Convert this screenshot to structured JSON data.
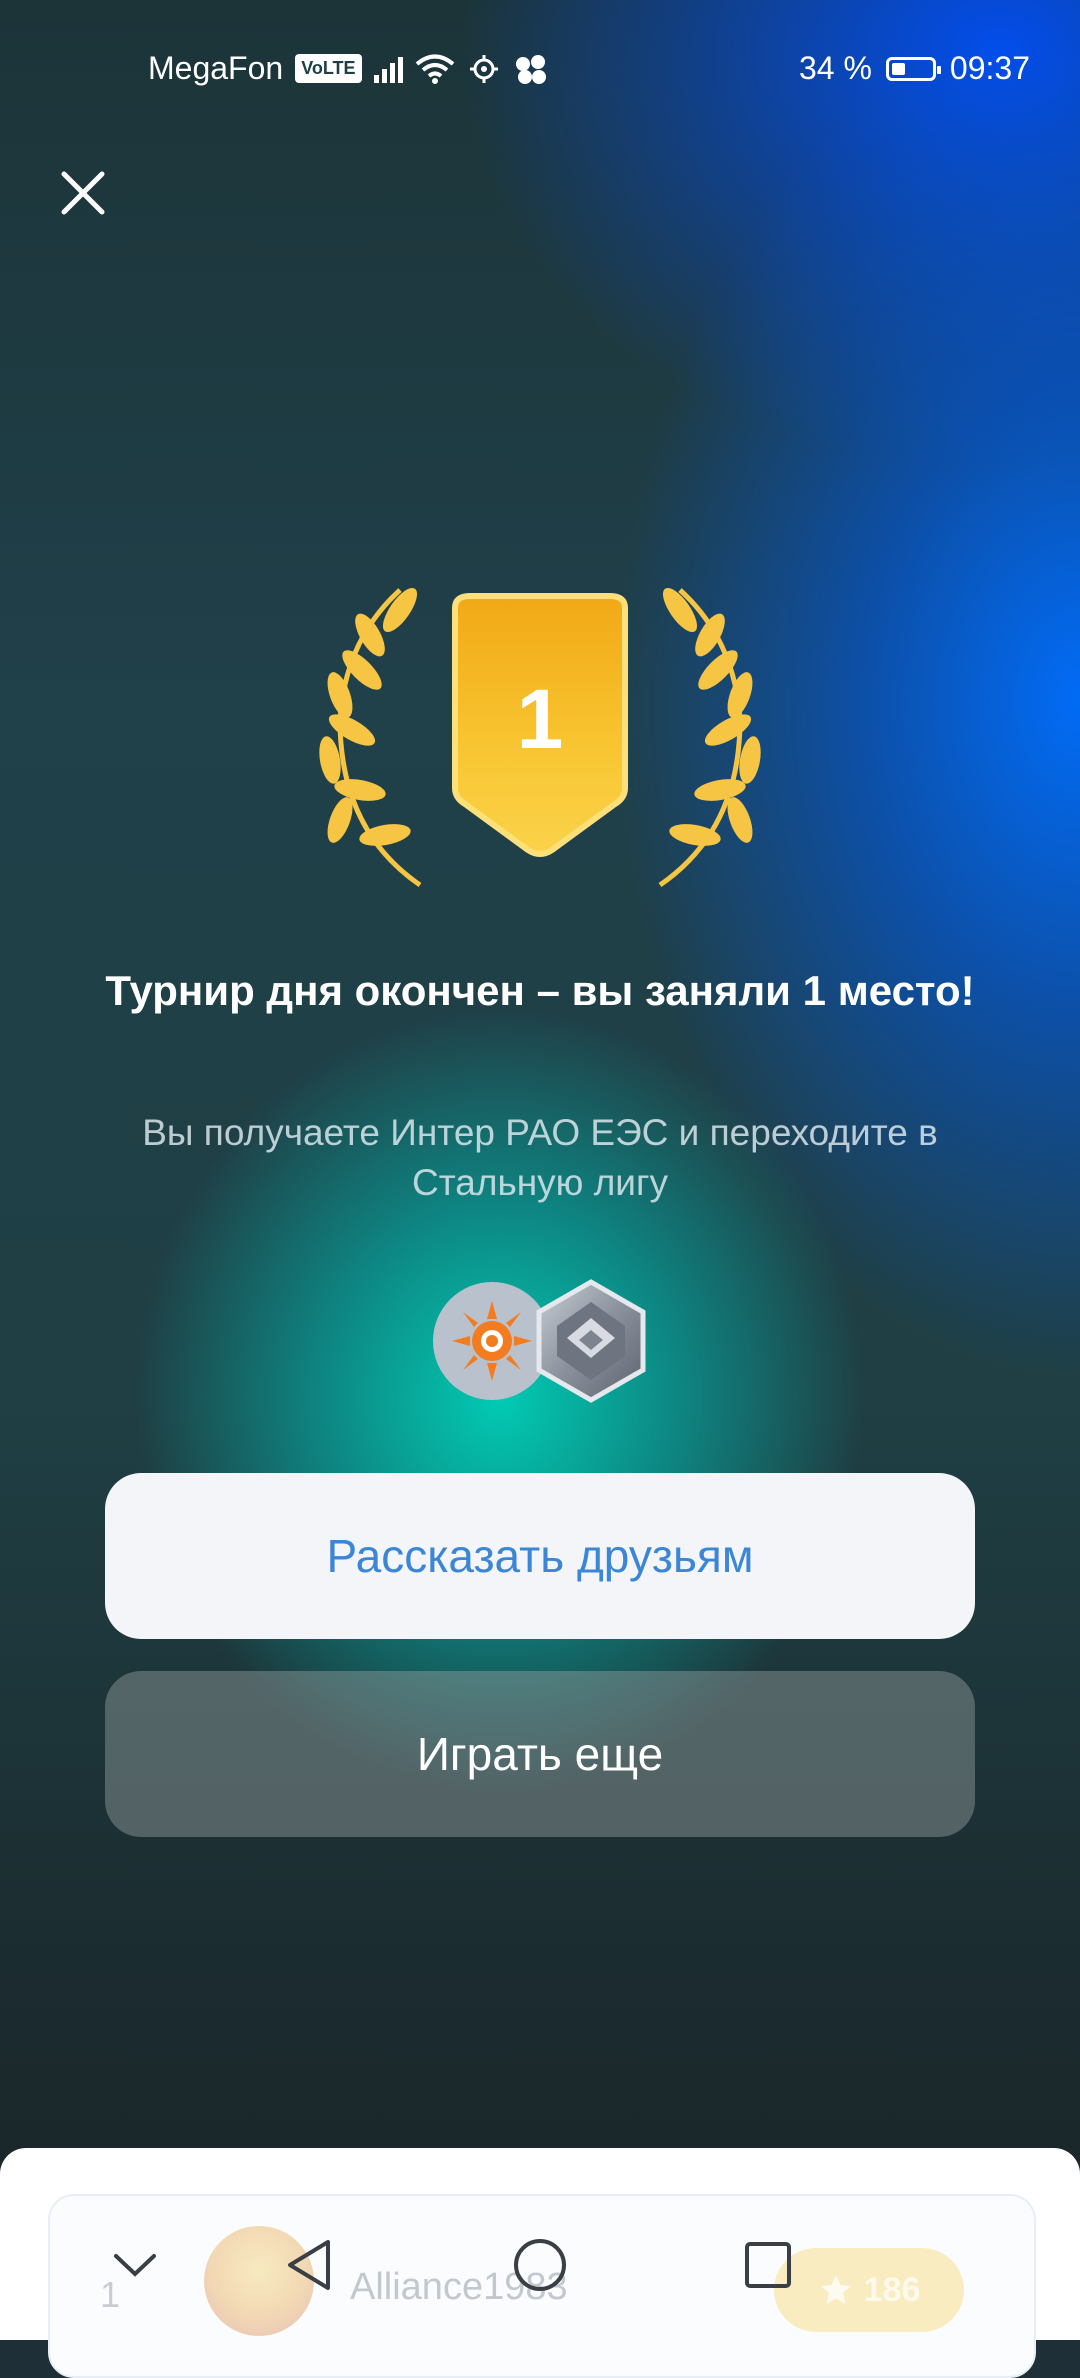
{
  "status_bar": {
    "carrier": "MegaFon",
    "volte": "VoLTE",
    "battery_percent": "34 %",
    "battery_level": 0.34,
    "time": "09:37"
  },
  "result": {
    "place": "1",
    "title": "Турнир дня окончен – вы заняли 1 место!",
    "subtitle": "Вы получаете Интер РАО ЕЭС и переходите в Стальную лигу"
  },
  "buttons": {
    "share": "Рассказать друзьям",
    "play_again": "Играть еще"
  },
  "leaderboard_row": {
    "rank": "1",
    "name": "Alliance1983",
    "score": "186"
  },
  "colors": {
    "accent_blue": "#3c86d6",
    "gold": "#f5b81c"
  }
}
